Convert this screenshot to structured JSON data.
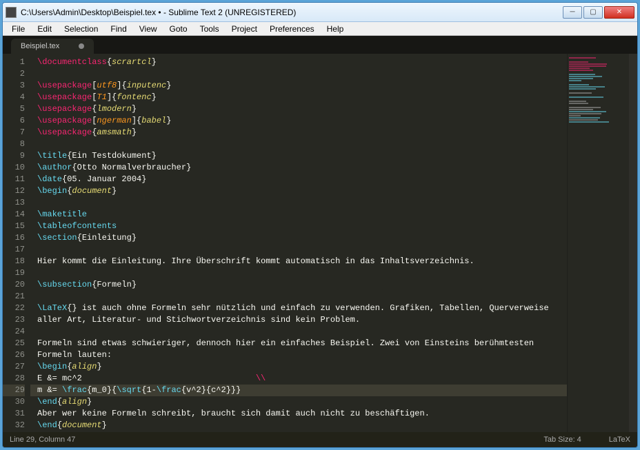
{
  "window": {
    "title": "C:\\Users\\Admin\\Desktop\\Beispiel.tex • - Sublime Text 2 (UNREGISTERED)"
  },
  "menu": [
    "File",
    "Edit",
    "Selection",
    "Find",
    "View",
    "Goto",
    "Tools",
    "Project",
    "Preferences",
    "Help"
  ],
  "tab": {
    "label": "Beispiel.tex"
  },
  "status": {
    "position": "Line 29, Column 47",
    "tabsize": "Tab Size: 4",
    "syntax": "LaTeX"
  },
  "active_line": 29,
  "code": [
    [
      [
        "key",
        "\\documentclass"
      ],
      [
        "br",
        "{"
      ],
      [
        "arg",
        "scrartcl"
      ],
      [
        "br",
        "}"
      ]
    ],
    [],
    [
      [
        "key",
        "\\usepackage"
      ],
      [
        "br",
        "["
      ],
      [
        "opt",
        "utf8"
      ],
      [
        "br",
        "]{"
      ],
      [
        "arg",
        "inputenc"
      ],
      [
        "br",
        "}"
      ]
    ],
    [
      [
        "key",
        "\\usepackage"
      ],
      [
        "br",
        "["
      ],
      [
        "opt",
        "T1"
      ],
      [
        "br",
        "]{"
      ],
      [
        "arg",
        "fontenc"
      ],
      [
        "br",
        "}"
      ]
    ],
    [
      [
        "key",
        "\\usepackage"
      ],
      [
        "br",
        "{"
      ],
      [
        "arg",
        "lmodern"
      ],
      [
        "br",
        "}"
      ]
    ],
    [
      [
        "key",
        "\\usepackage"
      ],
      [
        "br",
        "["
      ],
      [
        "opt",
        "ngerman"
      ],
      [
        "br",
        "]{"
      ],
      [
        "arg",
        "babel"
      ],
      [
        "br",
        "}"
      ]
    ],
    [
      [
        "key",
        "\\usepackage"
      ],
      [
        "br",
        "{"
      ],
      [
        "arg",
        "amsmath"
      ],
      [
        "br",
        "}"
      ]
    ],
    [],
    [
      [
        "cmd",
        "\\title"
      ],
      [
        "br",
        "{"
      ],
      [
        "txt",
        "Ein Testdokument"
      ],
      [
        "br",
        "}"
      ]
    ],
    [
      [
        "cmd",
        "\\author"
      ],
      [
        "br",
        "{"
      ],
      [
        "txt",
        "Otto Normalverbraucher"
      ],
      [
        "br",
        "}"
      ]
    ],
    [
      [
        "cmd",
        "\\date"
      ],
      [
        "br",
        "{"
      ],
      [
        "txt",
        "05. Januar 2004"
      ],
      [
        "br",
        "}"
      ]
    ],
    [
      [
        "cmd",
        "\\begin"
      ],
      [
        "br",
        "{"
      ],
      [
        "arg",
        "document"
      ],
      [
        "br",
        "}"
      ]
    ],
    [],
    [
      [
        "cmd",
        "\\maketitle"
      ]
    ],
    [
      [
        "cmd",
        "\\tableofcontents"
      ]
    ],
    [
      [
        "cmd",
        "\\section"
      ],
      [
        "br",
        "{"
      ],
      [
        "txt",
        "Einleitung"
      ],
      [
        "br",
        "}"
      ]
    ],
    [],
    [
      [
        "txt",
        "Hier kommt die Einleitung. Ihre Überschrift kommt automatisch in das Inhaltsverzeichnis."
      ]
    ],
    [],
    [
      [
        "cmd",
        "\\subsection"
      ],
      [
        "br",
        "{"
      ],
      [
        "txt",
        "Formeln"
      ],
      [
        "br",
        "}"
      ]
    ],
    [],
    [
      [
        "cmd",
        "\\LaTeX"
      ],
      [
        "br",
        "{}"
      ],
      [
        "txt",
        " ist auch ohne Formeln sehr nützlich und einfach zu verwenden. Grafiken, Tabellen, Querverweise"
      ]
    ],
    [
      [
        "txt",
        "aller Art, Literatur- und Stichwortverzeichnis sind kein Problem."
      ]
    ],
    [],
    [
      [
        "txt",
        "Formeln sind etwas schwieriger, dennoch hier ein einfaches Beispiel. Zwei von Einsteins berühmtesten"
      ]
    ],
    [
      [
        "txt",
        "Formeln lauten:"
      ]
    ],
    [
      [
        "cmd",
        "\\begin"
      ],
      [
        "br",
        "{"
      ],
      [
        "arg",
        "align"
      ],
      [
        "br",
        "}"
      ]
    ],
    [
      [
        "txt",
        "E &= mc^2                                   "
      ],
      [
        "slash",
        "\\\\"
      ]
    ],
    [
      [
        "txt",
        "m &= "
      ],
      [
        "cmd",
        "\\frac"
      ],
      [
        "br",
        "{"
      ],
      [
        "txt",
        "m_0"
      ],
      [
        "br",
        "}{"
      ],
      [
        "cmd",
        "\\sqrt"
      ],
      [
        "br",
        "{"
      ],
      [
        "txt",
        "1-"
      ],
      [
        "cmd",
        "\\frac"
      ],
      [
        "br",
        "{"
      ],
      [
        "txt",
        "v^2"
      ],
      [
        "br",
        "}{"
      ],
      [
        "txt",
        "c^2"
      ],
      [
        "br",
        "}}}"
      ]
    ],
    [
      [
        "cmd",
        "\\end"
      ],
      [
        "br",
        "{"
      ],
      [
        "arg",
        "align"
      ],
      [
        "br",
        "}"
      ]
    ],
    [
      [
        "txt",
        "Aber wer keine Formeln schreibt, braucht sich damit auch nicht zu beschäftigen."
      ]
    ],
    [
      [
        "cmd",
        "\\end"
      ],
      [
        "br",
        "{"
      ],
      [
        "arg",
        "document"
      ],
      [
        "br",
        "}"
      ]
    ]
  ],
  "minimap_colors": [
    "#f92672",
    "#000",
    "#f92672",
    "#f92672",
    "#f92672",
    "#f92672",
    "#f92672",
    "#000",
    "#66d9ef",
    "#66d9ef",
    "#66d9ef",
    "#66d9ef",
    "#000",
    "#66d9ef",
    "#66d9ef",
    "#66d9ef",
    "#000",
    "#aaa",
    "#000",
    "#66d9ef",
    "#000",
    "#aaa",
    "#aaa",
    "#000",
    "#aaa",
    "#aaa",
    "#66d9ef",
    "#aaa",
    "#aaa",
    "#66d9ef",
    "#aaa",
    "#66d9ef"
  ]
}
